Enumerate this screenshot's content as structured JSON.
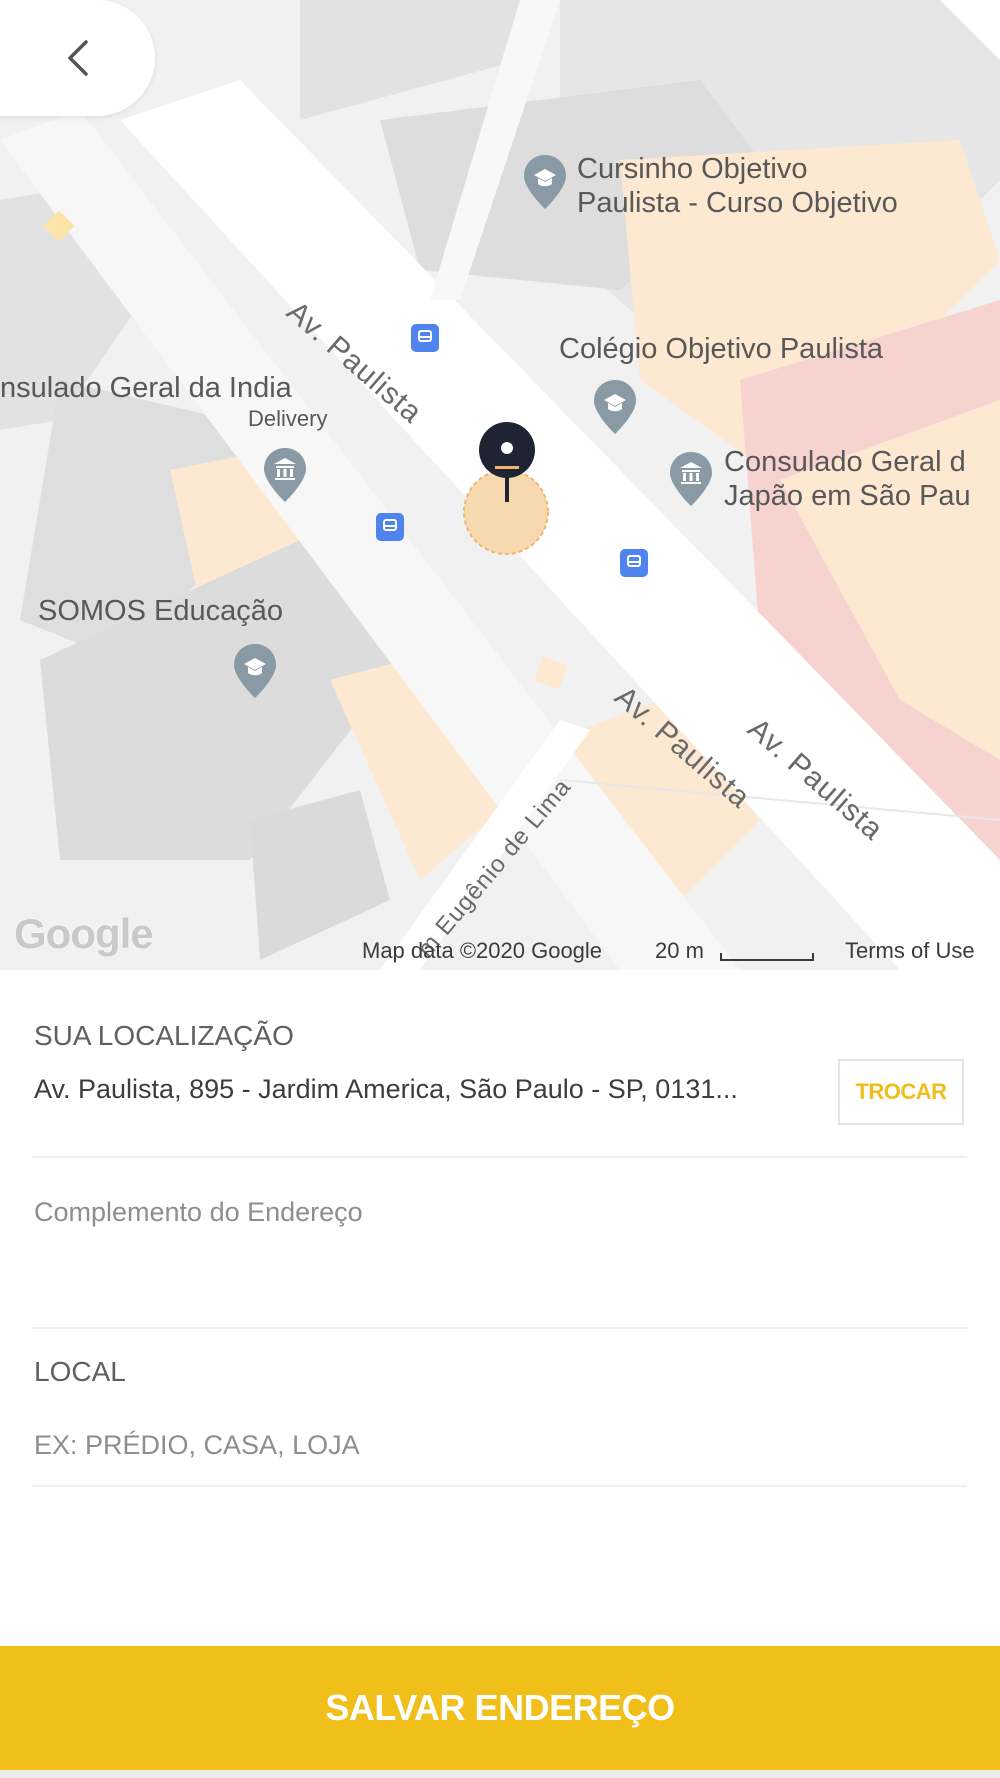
{
  "map": {
    "labels": {
      "poi_cursinho_line1": "Cursinho Objetivo",
      "poi_cursinho_line2": "Paulista - Curso Objetivo",
      "poi_colegio": "Colégio Objetivo Paulista",
      "poi_consulado_india": "nsulado Geral da India",
      "poi_delivery": "Delivery",
      "poi_consulado_japao_line1": "Consulado Geral d",
      "poi_consulado_japao_line2": "Japão em São Pau",
      "poi_somos": "SOMOS Educação",
      "street_paulista_1": "Av. Paulista",
      "street_paulista_2": "Av. Paulista",
      "street_paulista_3": "Av. Paulista",
      "street_eugenio": "m Eugênio de Lima"
    },
    "google_logo": "Google",
    "attribution": {
      "map_data": "Map data ©2020 Google",
      "scale": "20 m",
      "terms": "Terms of Use"
    },
    "colors": {
      "background": "#f1f1f1",
      "road": "#ffffff",
      "building": "#e3e3e3",
      "highlight_building": "#fde9d2",
      "pin": "#1f2433",
      "accuracy_circle": "#f7d9b0"
    }
  },
  "icons": {
    "back": "chevron-left-icon",
    "poi_school": "school-pin-icon",
    "poi_consulate": "consulate-pin-icon",
    "bus": "bus-stop-icon",
    "location": "location-pin-icon"
  },
  "form": {
    "location_label": "SUA LOCALIZAÇÃO",
    "address": "Av. Paulista, 895 - Jardim America, São Paulo - SP, 0131...",
    "change_button": "TROCAR",
    "complement_placeholder": "Complemento do Endereço",
    "complement_value": "",
    "local_label": "LOCAL",
    "local_placeholder": "EX: PRÉDIO, CASA, LOJA",
    "local_value": ""
  },
  "save_button": "SALVAR ENDEREÇO",
  "colors": {
    "accent": "#f0bf19",
    "accent_text": "#f0bd1b"
  }
}
